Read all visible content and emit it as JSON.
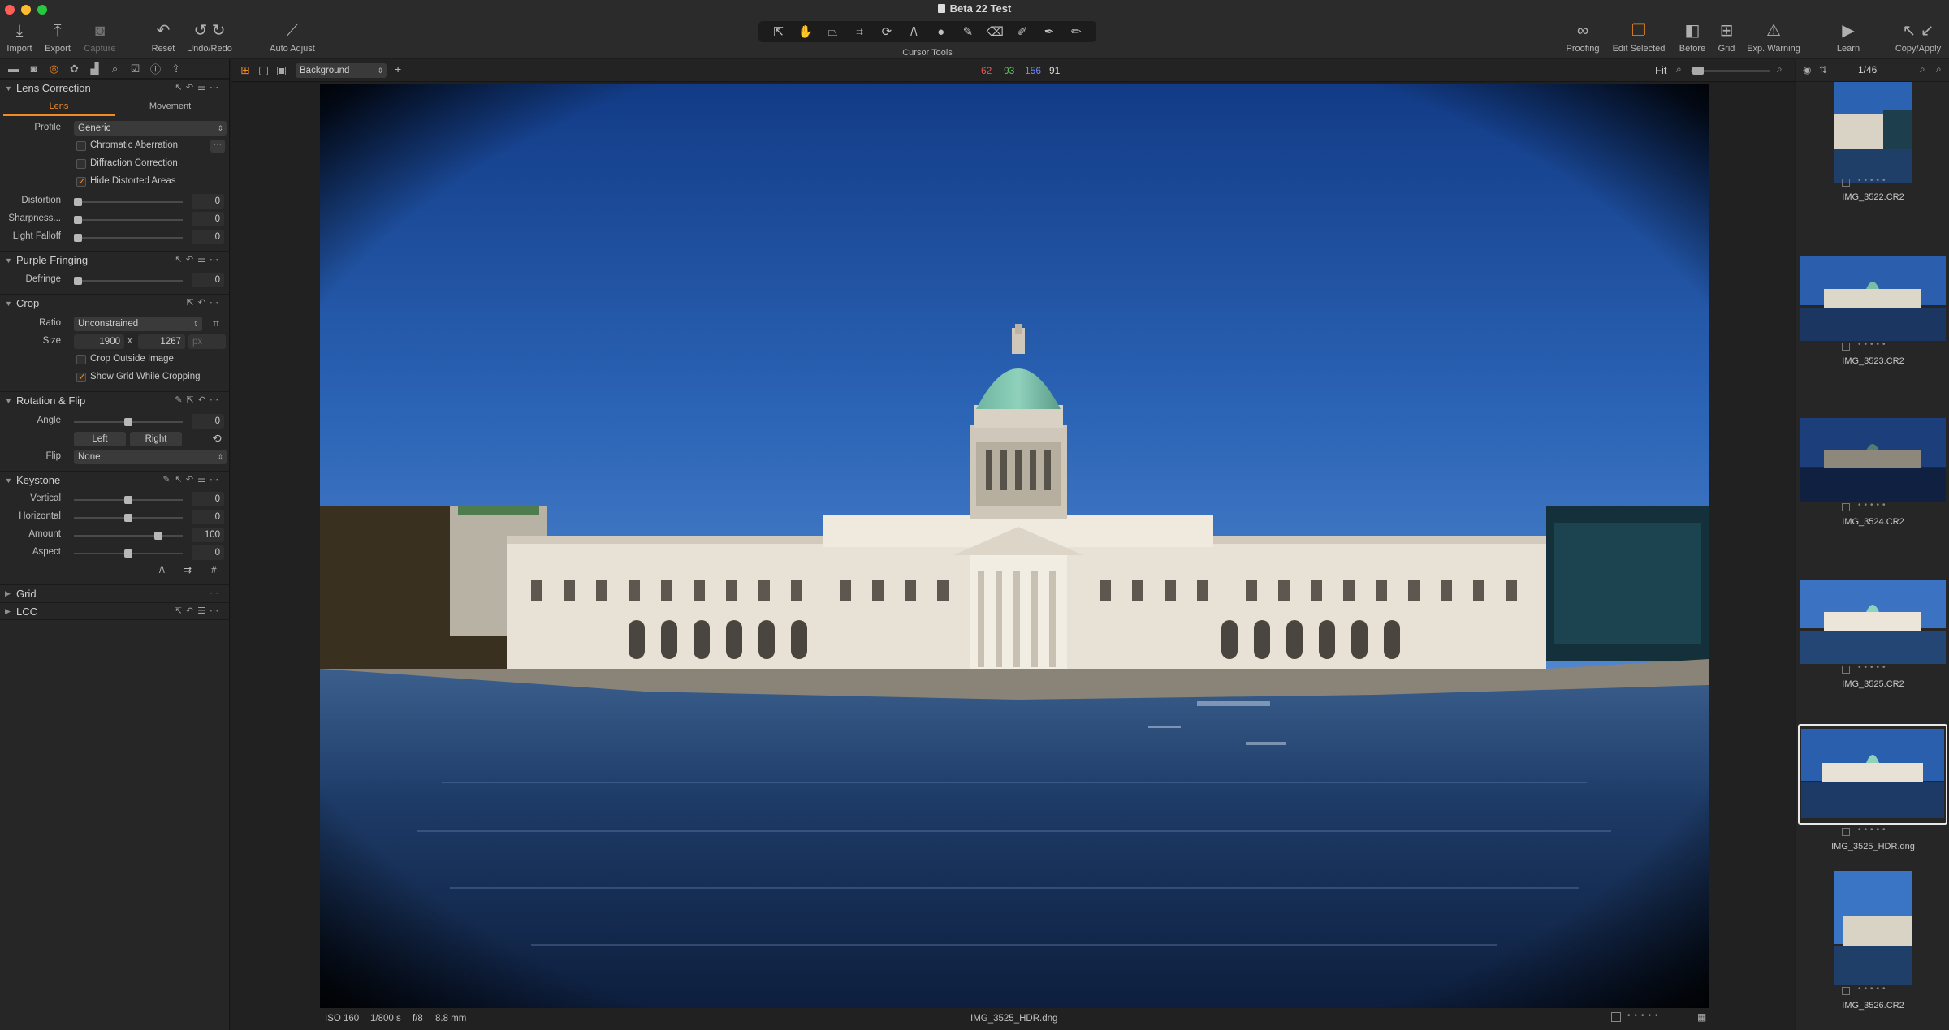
{
  "window": {
    "title": "Beta 22 Test"
  },
  "toolbar": {
    "left": [
      {
        "label": "Import",
        "icon": "import-icon"
      },
      {
        "label": "Export",
        "icon": "export-icon"
      },
      {
        "label": "Capture",
        "icon": "camera-icon"
      },
      {
        "label": "Reset",
        "icon": "reset-icon"
      },
      {
        "label": "Undo/Redo",
        "icon": "undo-icon"
      },
      {
        "label": "Auto Adjust",
        "icon": "magic-wand-icon"
      }
    ],
    "cursor_tools_label": "Cursor Tools",
    "right": [
      {
        "label": "Proofing",
        "icon": "glasses-icon"
      },
      {
        "label": "Edit Selected",
        "icon": "stack-icon"
      },
      {
        "label": "Before",
        "icon": "before-icon"
      },
      {
        "label": "Grid",
        "icon": "grid-icon"
      },
      {
        "label": "Exp. Warning",
        "icon": "warning-icon"
      },
      {
        "label": "Learn",
        "icon": "learn-icon"
      },
      {
        "label": "Copy/Apply",
        "icon": "copy-apply-icon"
      }
    ]
  },
  "viewerbar": {
    "layer": "Background",
    "rgb": {
      "r": "62",
      "g": "93",
      "b": "156",
      "l": "91"
    },
    "zoom": "Fit"
  },
  "lens_correction": {
    "title": "Lens Correction",
    "tabs": [
      "Lens",
      "Movement"
    ],
    "profile_label": "Profile",
    "profile": "Generic",
    "chromatic_aberration": "Chromatic Aberration",
    "diffraction_correction": "Diffraction Correction",
    "hide_distorted": "Hide Distorted Areas",
    "distortion_label": "Distortion",
    "distortion": "0",
    "sharpness_label": "Sharpness...",
    "sharpness": "0",
    "light_falloff_label": "Light Falloff",
    "light_falloff": "0"
  },
  "purple_fringing": {
    "title": "Purple Fringing",
    "defringe_label": "Defringe",
    "defringe": "0"
  },
  "crop": {
    "title": "Crop",
    "ratio_label": "Ratio",
    "ratio": "Unconstrained",
    "size_label": "Size",
    "width": "1900",
    "x": "x",
    "height": "1267",
    "unit": "px",
    "crop_outside": "Crop Outside Image",
    "show_grid": "Show Grid While Cropping"
  },
  "rotation_flip": {
    "title": "Rotation & Flip",
    "angle_label": "Angle",
    "angle": "0",
    "left": "Left",
    "right": "Right",
    "flip_label": "Flip",
    "flip": "None"
  },
  "keystone": {
    "title": "Keystone",
    "vertical_label": "Vertical",
    "vertical": "0",
    "horizontal_label": "Horizontal",
    "horizontal": "0",
    "amount_label": "Amount",
    "amount": "100",
    "aspect_label": "Aspect",
    "aspect": "0"
  },
  "grid_section": {
    "title": "Grid"
  },
  "lcc_section": {
    "title": "LCC"
  },
  "footer": {
    "iso": "ISO 160",
    "shutter": "1/800 s",
    "aperture": "f/8",
    "focal": "8.8 mm",
    "filename": "IMG_3525_HDR.dng"
  },
  "browser": {
    "count": "1/46",
    "thumbnails": [
      {
        "name": "IMG_3522.CR2"
      },
      {
        "name": "IMG_3523.CR2"
      },
      {
        "name": "IMG_3524.CR2"
      },
      {
        "name": "IMG_3525.CR2"
      },
      {
        "name": "IMG_3525_HDR.dng"
      },
      {
        "name": "IMG_3526.CR2"
      }
    ]
  },
  "colors": {
    "accent": "#f08a24",
    "sky": "#2a5fae",
    "red": "#e05a5a",
    "green": "#5fc25f",
    "blue": "#6b8cff"
  }
}
